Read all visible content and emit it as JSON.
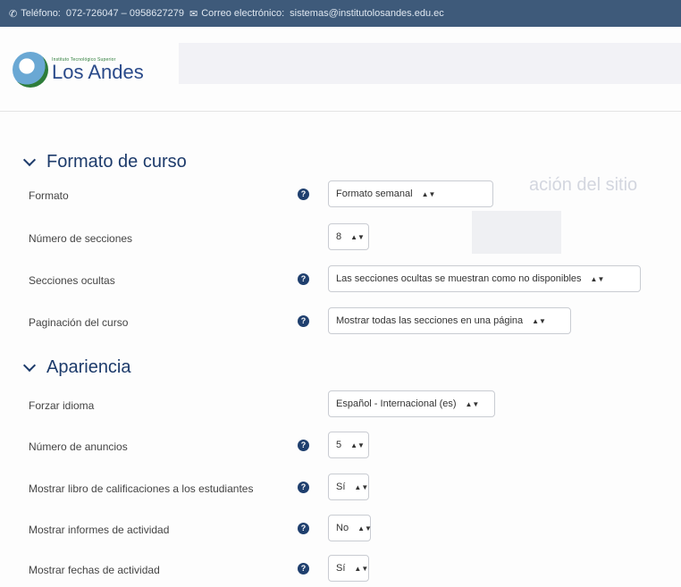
{
  "topbar": {
    "phone_label": "Teléfono:",
    "phone_numbers": "072-726047 – 0958627279",
    "email_label": "Correo electrónico:",
    "email": "sistemas@institutolosandes.edu.ec"
  },
  "logo": {
    "small_text": "Instituto Tecnológico Superior",
    "name": "Los Andes"
  },
  "ghost": {
    "title": "ación del sitio"
  },
  "sections": {
    "formato": {
      "title": "Formato de curso",
      "rows": [
        {
          "label": "Formato",
          "value": "Formato semanal"
        },
        {
          "label": "Número de secciones",
          "value": "8"
        },
        {
          "label": "Secciones ocultas",
          "value": "Las secciones ocultas se muestran como no disponibles"
        },
        {
          "label": "Paginación del curso",
          "value": "Mostrar todas las secciones en una página"
        }
      ]
    },
    "apariencia": {
      "title": "Apariencia",
      "rows": [
        {
          "label": "Forzar idioma",
          "value": "Español - Internacional (es)"
        },
        {
          "label": "Número de anuncios",
          "value": "5"
        },
        {
          "label": "Mostrar libro de calificaciones a los estudiantes",
          "value": "Sí"
        },
        {
          "label": "Mostrar informes de actividad",
          "value": "No"
        },
        {
          "label": "Mostrar fechas de actividad",
          "value": "Sí"
        }
      ]
    }
  },
  "icons": {
    "help": "?",
    "select_arrow": "▲▼"
  },
  "colors": {
    "topbar": "#3e5a7a",
    "heading": "#1d3b6b",
    "help_icon": "#1f3f6e"
  }
}
